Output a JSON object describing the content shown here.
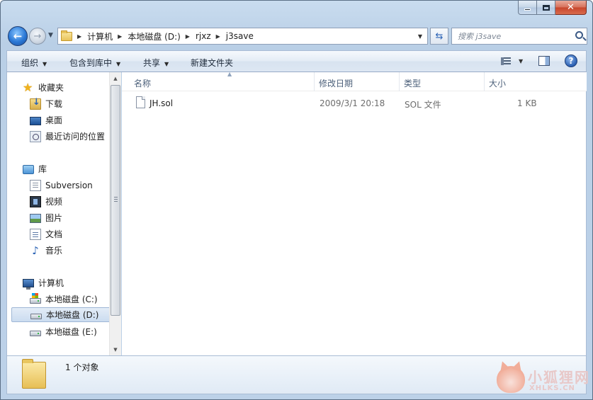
{
  "window": {
    "caption_minimize": "",
    "caption_maximize": "",
    "caption_close": "✕"
  },
  "address": {
    "crumbs": [
      "计算机",
      "本地磁盘 (D:)",
      "rjxz",
      "j3save"
    ],
    "search_placeholder": "搜索 j3save"
  },
  "toolbar": {
    "organize": "组织",
    "include_in_library": "包含到库中",
    "share": "共享",
    "new_folder": "新建文件夹",
    "help": "?"
  },
  "sidebar": {
    "favorites": {
      "label": "收藏夹",
      "items": [
        "下载",
        "桌面",
        "最近访问的位置"
      ]
    },
    "libraries": {
      "label": "库",
      "items": [
        "Subversion",
        "视频",
        "图片",
        "文档",
        "音乐"
      ]
    },
    "computer": {
      "label": "计算机",
      "items": [
        "本地磁盘 (C:)",
        "本地磁盘 (D:)",
        "本地磁盘 (E:)"
      ],
      "selected": "本地磁盘 (D:)"
    }
  },
  "file_list": {
    "columns": [
      "名称",
      "修改日期",
      "类型",
      "大小"
    ],
    "rows": [
      {
        "name": "JH.sol",
        "modified": "2009/3/1 20:18",
        "type": "SOL 文件",
        "size": "1 KB"
      }
    ]
  },
  "details": {
    "status": "1 个对象"
  },
  "watermark": {
    "title": "小狐狸网",
    "subtitle": "XHLKS.CN"
  },
  "colors": {
    "frame": "#bcd1e8",
    "selection": "#cbdcf0",
    "header_text": "#4c607a"
  }
}
